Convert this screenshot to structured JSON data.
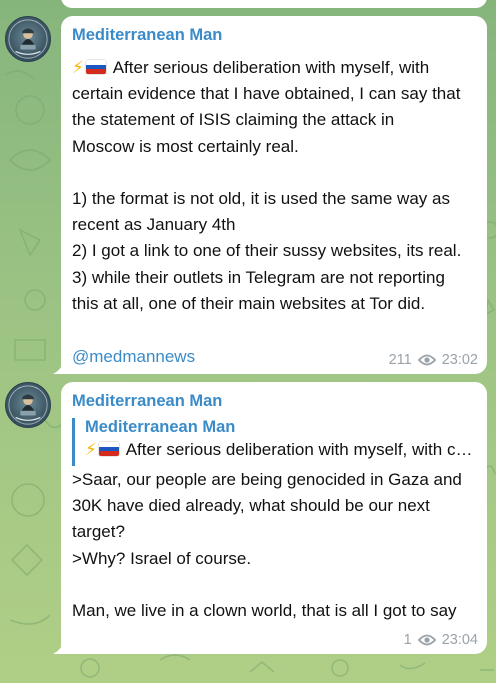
{
  "chat": {
    "wallpaper_colors": [
      "#86b57c",
      "#b0cf86"
    ],
    "accent_color": "#3a8bc8"
  },
  "messages": [
    {
      "sender": "Mediterranean Man",
      "avatar_icon": "mediterranean-man-avatar",
      "text_prefix_icons": [
        "lightning-emoji",
        "russian-flag-emoji"
      ],
      "text_lines": {
        "l1": " After serious deliberation with myself, with",
        "l2": "certain evidence that I have obtained, I can say that",
        "l3": "the statement of ISIS claiming the attack in",
        "l4": "Moscow is most certainly real.",
        "l5": "",
        "l6": "1) the format is not old, it is used the same way as",
        "l7": "recent as January 4th",
        "l8": "2) I got a link to one of their sussy websites, its real.",
        "l9": "3) while their outlets in Telegram are not reporting",
        "l10": "this at all, one of their main websites at Tor did."
      },
      "link": "@medmannews",
      "views": "211",
      "time": "23:02"
    },
    {
      "sender": "Mediterranean Man",
      "avatar_icon": "mediterranean-man-avatar",
      "reply": {
        "sender": "Mediterranean Man",
        "text": " After serious deliberation with myself, with certain evidence that I have obtained"
      },
      "text_lines": {
        "l1": ">Saar, our people are being genocided in Gaza and",
        "l2": "30K have died already, what should be our next",
        "l3": "target?",
        "l4": ">Why? Israel of course.",
        "l5": "",
        "l6": "Man, we live in a clown world, that is all I got to say"
      },
      "views": "1",
      "time": "23:04"
    }
  ]
}
